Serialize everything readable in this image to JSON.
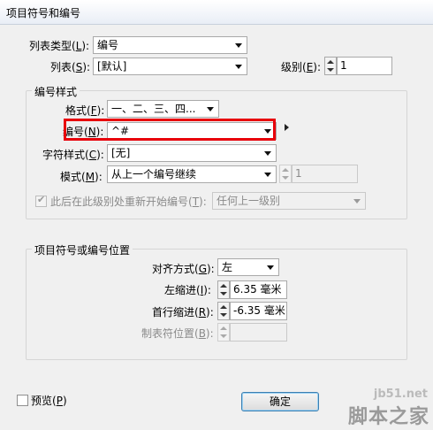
{
  "window": {
    "title": "项目符号和编号"
  },
  "top": {
    "list_type_label": "列表类型(",
    "list_type_key": "L",
    "list_type_label_end": "):",
    "list_type_value": "编号",
    "list_label": "列表(",
    "list_key": "S",
    "list_label_end": "):",
    "list_value": "[默认]",
    "level_label": "级别(",
    "level_key": "E",
    "level_label_end": "):",
    "level_value": "1"
  },
  "numbering_style": {
    "group_title": "编号样式",
    "format_label": "格式(",
    "format_key": "F",
    "format_label_end": "):",
    "format_value": "一、二、三、四...",
    "number_label": "编号(",
    "number_key": "N",
    "number_label_end": "):",
    "number_value": "^#",
    "char_style_label": "字符样式(",
    "char_style_key": "C",
    "char_style_label_end": "):",
    "char_style_value": "[无]",
    "mode_label": "模式(",
    "mode_key": "M",
    "mode_label_end": "):",
    "mode_value": "从上一个编号继续",
    "mode_number": "1",
    "restart_label": "此后在此级别处重新开始编号(",
    "restart_key": "T",
    "restart_label_end": "):",
    "restart_checked": true,
    "restart_value": "任何上一级别"
  },
  "position": {
    "group_title": "项目符号或编号位置",
    "align_label": "对齐方式(",
    "align_key": "G",
    "align_label_end": "):",
    "align_value": "左",
    "left_indent_label": "左缩进(",
    "left_indent_key": "I",
    "left_indent_label_end": "):",
    "left_indent_value": "6.35 毫米",
    "first_indent_label": "首行缩进(",
    "first_indent_key": "R",
    "first_indent_label_end": "):",
    "first_indent_value": "-6.35 毫米",
    "tab_label": "制表符位置(",
    "tab_key": "B",
    "tab_label_end": "):",
    "tab_value": ""
  },
  "footer": {
    "preview_label": "预览(",
    "preview_key": "P",
    "preview_label_end": ")",
    "preview_checked": false,
    "ok_label": "确定"
  },
  "watermark": {
    "url": "jb51.net",
    "name": "脚本之家"
  },
  "colors": {
    "highlight": "#e8000b",
    "dialog_bg": "#f0f0f0"
  }
}
